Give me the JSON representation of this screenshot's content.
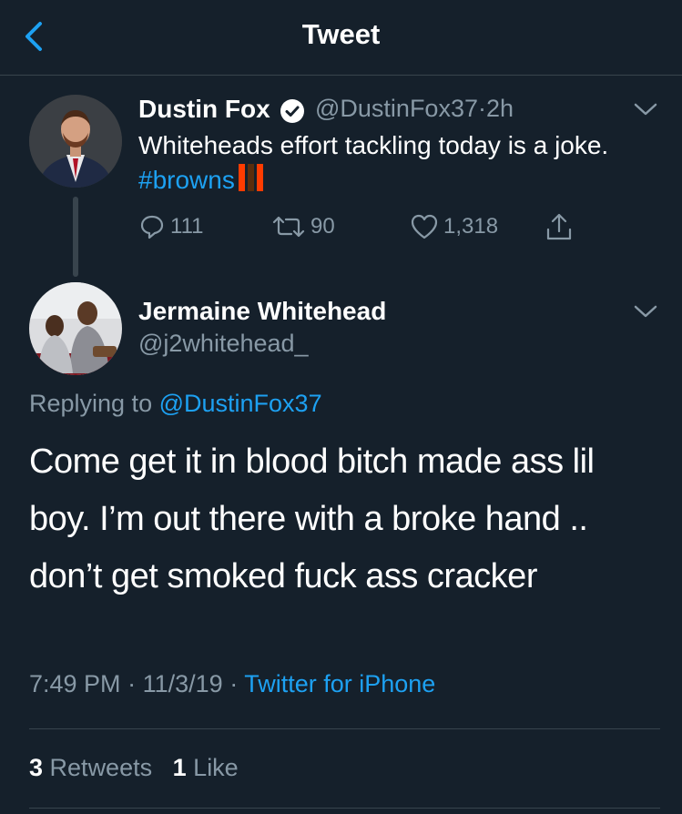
{
  "header": {
    "title": "Tweet"
  },
  "original_tweet": {
    "author_name": "Dustin Fox",
    "handle": "@DustinFox37",
    "separator": "·",
    "age": "2h",
    "text_before": "Whiteheads effort tackling today is a joke.",
    "hashtag": "#browns",
    "replies": "111",
    "retweets": "90",
    "likes": "1,318"
  },
  "reply_tweet": {
    "author_name": "Jermaine Whitehead",
    "handle": "@j2whitehead_",
    "replying_to_label": "Replying to",
    "replying_to_handle": "@DustinFox37",
    "text": "Come get it in blood bitch made ass lil boy. I’m out there with a broke hand .. don’t get smoked fuck ass cracker",
    "time": "7:49 PM",
    "date": "11/3/19",
    "separator": "·",
    "source": "Twitter for iPhone",
    "retweet_count": "3",
    "retweet_label": "Retweets",
    "like_count": "1",
    "like_label": "Like"
  },
  "colors": {
    "background": "#15202b",
    "accent": "#1da1f2",
    "secondary_text": "#8899a6",
    "divider": "#38444d",
    "flag_orange": "#ff3c00",
    "flag_brown": "#5a2d0c"
  },
  "icons": [
    "back-arrow-icon",
    "verified-badge-icon",
    "chevron-down-icon",
    "reply-icon",
    "retweet-icon",
    "like-icon",
    "share-icon"
  ]
}
